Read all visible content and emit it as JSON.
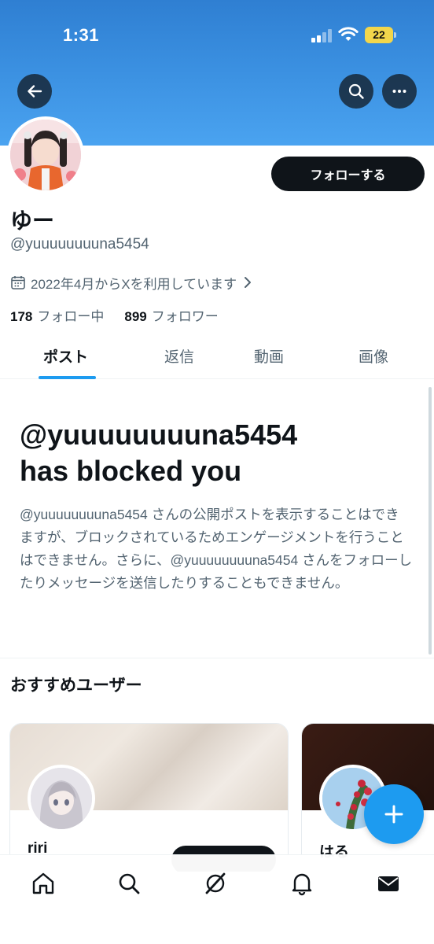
{
  "status_bar": {
    "time": "1:31",
    "battery": "22"
  },
  "profile": {
    "name": "ゆー",
    "handle": "@yuuuuuuuuna5454",
    "joined": "2022年4月からXを利用しています",
    "following_count": "178",
    "following_label": "フォロー中",
    "followers_count": "899",
    "followers_label": "フォロワー",
    "follow_button": "フォローする"
  },
  "tabs": [
    {
      "label": "ポスト",
      "active": true
    },
    {
      "label": "返信",
      "active": false
    },
    {
      "label": "動画",
      "active": false
    },
    {
      "label": "画像",
      "active": false
    }
  ],
  "blocked": {
    "title_line1": "@yuuuuuuuuna5454",
    "title_line2": "has blocked you",
    "description": "@yuuuuuuuuna5454 さんの公開ポストを表示することはできますが、ブロックされているためエンゲージメントを行うことはできません。さらに、@yuuuuuuuuna5454 さんをフォローしたりメッセージを送信したりすることもできません。"
  },
  "recommendations": {
    "title": "おすすめユーザー",
    "users": [
      {
        "name": "riri"
      },
      {
        "name": "はる"
      }
    ]
  },
  "bottom_nav": [
    "home-icon",
    "search-icon",
    "grok-icon",
    "bell-icon",
    "mail-icon"
  ],
  "colors": {
    "accent": "#1d9bf0",
    "banner": "#3a8fe0",
    "text": "#0f1419",
    "muted": "#536471"
  }
}
